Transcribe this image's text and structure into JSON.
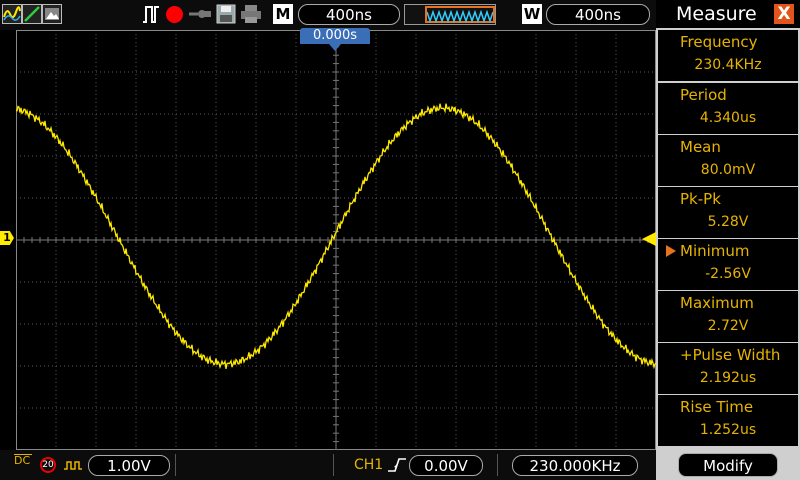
{
  "toolbar": {
    "timebase_label": "M",
    "timebase_value": "400ns",
    "window_label": "W",
    "window_value": "400ns",
    "icons": [
      "waveform-icon",
      "cursor-icon",
      "save-icon",
      "run-stop-icon",
      "probe-icon",
      "disk-icon",
      "print-icon"
    ]
  },
  "screen": {
    "trigger_position": "0.000s",
    "ch1_marker": "1",
    "trace_color": "#ffea00",
    "grid_color": "#5a5a5a"
  },
  "bottombar": {
    "coupling": "DC",
    "bandwidth": "20",
    "ch1_scale": "1.00V",
    "trigger_source": "CH1",
    "trigger_level": "0.00V",
    "trigger_frequency": "230.000KHz"
  },
  "panel": {
    "title": "Measure",
    "close": "X",
    "accent": "#e6b400",
    "items": [
      {
        "label": "Frequency",
        "value": "230.4KHz"
      },
      {
        "label": "Period",
        "value": "4.340us"
      },
      {
        "label": "Mean",
        "value": "80.0mV"
      },
      {
        "label": "Pk-Pk",
        "value": "5.28V"
      },
      {
        "label": "Minimum",
        "value": "-2.56V"
      },
      {
        "label": "Maximum",
        "value": "2.72V"
      },
      {
        "label": "+Pulse Width",
        "value": "2.192us"
      },
      {
        "label": "Rise Time",
        "value": "1.252us"
      }
    ],
    "modify": "Modify"
  }
}
